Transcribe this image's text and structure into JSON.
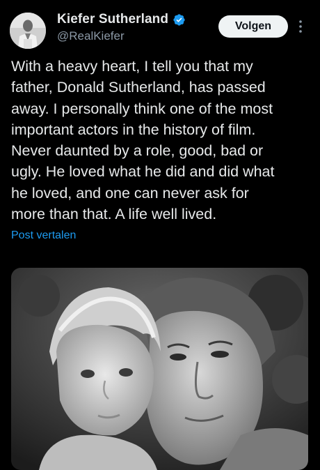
{
  "tweet": {
    "author": {
      "display_name": "Kiefer Sutherland",
      "handle": "@RealKiefer",
      "verified_icon": "verified-badge-icon",
      "verified_color": "#1d9bf0"
    },
    "follow_label": "Volgen",
    "more_icon": "more-options-icon",
    "text": "With a heavy heart, I tell you that my\nfather, Donald Sutherland, has passed\naway. I personally think one of the most\nimportant actors in the history of film.\nNever daunted by a role, good, bad or\nugly. He loved what he did and did what\nhe loved, and one can never ask for\nmore than that. A life well lived.",
    "translate_label": "Post vertalen",
    "colors": {
      "background": "#000000",
      "text": "#e7e9ea",
      "secondary": "#8b98a5",
      "link": "#1d9bf0",
      "button_bg": "#eff3f4"
    }
  }
}
